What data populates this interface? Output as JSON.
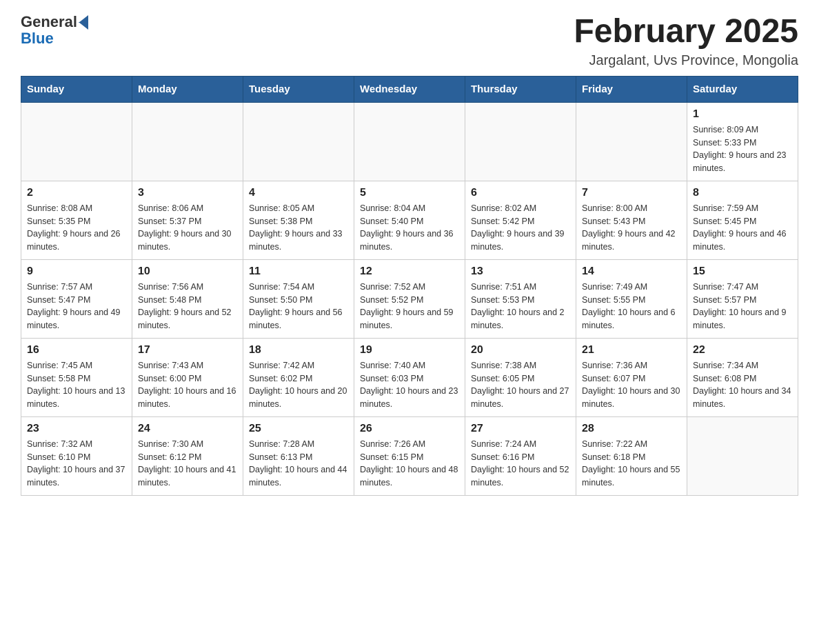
{
  "header": {
    "logo": {
      "text_general": "General",
      "text_blue": "Blue"
    },
    "title": "February 2025",
    "subtitle": "Jargalant, Uvs Province, Mongolia"
  },
  "weekdays": [
    "Sunday",
    "Monday",
    "Tuesday",
    "Wednesday",
    "Thursday",
    "Friday",
    "Saturday"
  ],
  "weeks": [
    [
      {
        "day": "",
        "sunrise": "",
        "sunset": "",
        "daylight": ""
      },
      {
        "day": "",
        "sunrise": "",
        "sunset": "",
        "daylight": ""
      },
      {
        "day": "",
        "sunrise": "",
        "sunset": "",
        "daylight": ""
      },
      {
        "day": "",
        "sunrise": "",
        "sunset": "",
        "daylight": ""
      },
      {
        "day": "",
        "sunrise": "",
        "sunset": "",
        "daylight": ""
      },
      {
        "day": "",
        "sunrise": "",
        "sunset": "",
        "daylight": ""
      },
      {
        "day": "1",
        "sunrise": "Sunrise: 8:09 AM",
        "sunset": "Sunset: 5:33 PM",
        "daylight": "Daylight: 9 hours and 23 minutes."
      }
    ],
    [
      {
        "day": "2",
        "sunrise": "Sunrise: 8:08 AM",
        "sunset": "Sunset: 5:35 PM",
        "daylight": "Daylight: 9 hours and 26 minutes."
      },
      {
        "day": "3",
        "sunrise": "Sunrise: 8:06 AM",
        "sunset": "Sunset: 5:37 PM",
        "daylight": "Daylight: 9 hours and 30 minutes."
      },
      {
        "day": "4",
        "sunrise": "Sunrise: 8:05 AM",
        "sunset": "Sunset: 5:38 PM",
        "daylight": "Daylight: 9 hours and 33 minutes."
      },
      {
        "day": "5",
        "sunrise": "Sunrise: 8:04 AM",
        "sunset": "Sunset: 5:40 PM",
        "daylight": "Daylight: 9 hours and 36 minutes."
      },
      {
        "day": "6",
        "sunrise": "Sunrise: 8:02 AM",
        "sunset": "Sunset: 5:42 PM",
        "daylight": "Daylight: 9 hours and 39 minutes."
      },
      {
        "day": "7",
        "sunrise": "Sunrise: 8:00 AM",
        "sunset": "Sunset: 5:43 PM",
        "daylight": "Daylight: 9 hours and 42 minutes."
      },
      {
        "day": "8",
        "sunrise": "Sunrise: 7:59 AM",
        "sunset": "Sunset: 5:45 PM",
        "daylight": "Daylight: 9 hours and 46 minutes."
      }
    ],
    [
      {
        "day": "9",
        "sunrise": "Sunrise: 7:57 AM",
        "sunset": "Sunset: 5:47 PM",
        "daylight": "Daylight: 9 hours and 49 minutes."
      },
      {
        "day": "10",
        "sunrise": "Sunrise: 7:56 AM",
        "sunset": "Sunset: 5:48 PM",
        "daylight": "Daylight: 9 hours and 52 minutes."
      },
      {
        "day": "11",
        "sunrise": "Sunrise: 7:54 AM",
        "sunset": "Sunset: 5:50 PM",
        "daylight": "Daylight: 9 hours and 56 minutes."
      },
      {
        "day": "12",
        "sunrise": "Sunrise: 7:52 AM",
        "sunset": "Sunset: 5:52 PM",
        "daylight": "Daylight: 9 hours and 59 minutes."
      },
      {
        "day": "13",
        "sunrise": "Sunrise: 7:51 AM",
        "sunset": "Sunset: 5:53 PM",
        "daylight": "Daylight: 10 hours and 2 minutes."
      },
      {
        "day": "14",
        "sunrise": "Sunrise: 7:49 AM",
        "sunset": "Sunset: 5:55 PM",
        "daylight": "Daylight: 10 hours and 6 minutes."
      },
      {
        "day": "15",
        "sunrise": "Sunrise: 7:47 AM",
        "sunset": "Sunset: 5:57 PM",
        "daylight": "Daylight: 10 hours and 9 minutes."
      }
    ],
    [
      {
        "day": "16",
        "sunrise": "Sunrise: 7:45 AM",
        "sunset": "Sunset: 5:58 PM",
        "daylight": "Daylight: 10 hours and 13 minutes."
      },
      {
        "day": "17",
        "sunrise": "Sunrise: 7:43 AM",
        "sunset": "Sunset: 6:00 PM",
        "daylight": "Daylight: 10 hours and 16 minutes."
      },
      {
        "day": "18",
        "sunrise": "Sunrise: 7:42 AM",
        "sunset": "Sunset: 6:02 PM",
        "daylight": "Daylight: 10 hours and 20 minutes."
      },
      {
        "day": "19",
        "sunrise": "Sunrise: 7:40 AM",
        "sunset": "Sunset: 6:03 PM",
        "daylight": "Daylight: 10 hours and 23 minutes."
      },
      {
        "day": "20",
        "sunrise": "Sunrise: 7:38 AM",
        "sunset": "Sunset: 6:05 PM",
        "daylight": "Daylight: 10 hours and 27 minutes."
      },
      {
        "day": "21",
        "sunrise": "Sunrise: 7:36 AM",
        "sunset": "Sunset: 6:07 PM",
        "daylight": "Daylight: 10 hours and 30 minutes."
      },
      {
        "day": "22",
        "sunrise": "Sunrise: 7:34 AM",
        "sunset": "Sunset: 6:08 PM",
        "daylight": "Daylight: 10 hours and 34 minutes."
      }
    ],
    [
      {
        "day": "23",
        "sunrise": "Sunrise: 7:32 AM",
        "sunset": "Sunset: 6:10 PM",
        "daylight": "Daylight: 10 hours and 37 minutes."
      },
      {
        "day": "24",
        "sunrise": "Sunrise: 7:30 AM",
        "sunset": "Sunset: 6:12 PM",
        "daylight": "Daylight: 10 hours and 41 minutes."
      },
      {
        "day": "25",
        "sunrise": "Sunrise: 7:28 AM",
        "sunset": "Sunset: 6:13 PM",
        "daylight": "Daylight: 10 hours and 44 minutes."
      },
      {
        "day": "26",
        "sunrise": "Sunrise: 7:26 AM",
        "sunset": "Sunset: 6:15 PM",
        "daylight": "Daylight: 10 hours and 48 minutes."
      },
      {
        "day": "27",
        "sunrise": "Sunrise: 7:24 AM",
        "sunset": "Sunset: 6:16 PM",
        "daylight": "Daylight: 10 hours and 52 minutes."
      },
      {
        "day": "28",
        "sunrise": "Sunrise: 7:22 AM",
        "sunset": "Sunset: 6:18 PM",
        "daylight": "Daylight: 10 hours and 55 minutes."
      },
      {
        "day": "",
        "sunrise": "",
        "sunset": "",
        "daylight": ""
      }
    ]
  ]
}
